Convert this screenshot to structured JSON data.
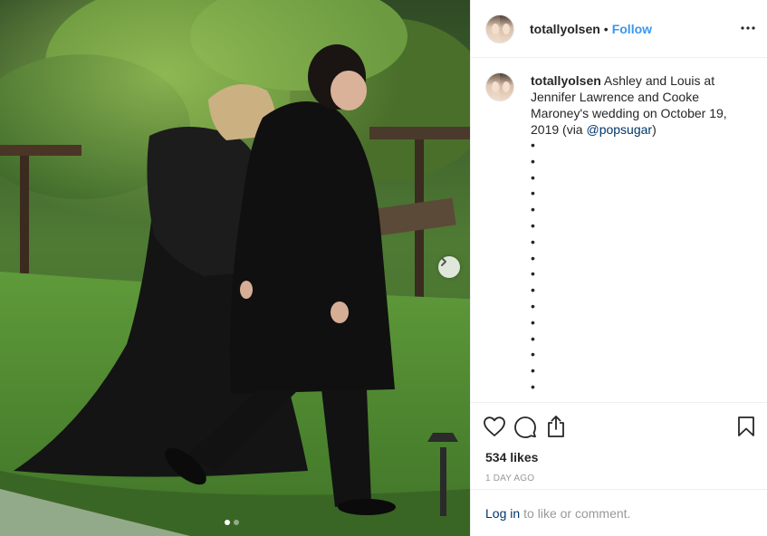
{
  "post": {
    "username": "totallyolsen",
    "separator": "•",
    "follow_label": "Follow",
    "more_icon": "more-options-icon",
    "caption": {
      "username": "totallyolsen",
      "text_before_mention": " Ashley and Louis at Jennifer Lawrence and Cooke Maroney's wedding on October 19, 2019 (via ",
      "mention": "@popsugar",
      "text_after_mention": ")",
      "bullets": [
        "•",
        "•",
        "•",
        "•",
        "•",
        "•",
        "•",
        "•",
        "•",
        "•",
        "•",
        "•",
        "•",
        "•",
        "•",
        "•"
      ]
    },
    "likes": "534 likes",
    "timestamp": "1 DAY AGO",
    "carousel": {
      "current": 1,
      "total": 2
    },
    "login_prompt": {
      "link": "Log in",
      "rest": "to like or comment."
    }
  },
  "icons": [
    "heart-icon",
    "comment-icon",
    "share-icon",
    "bookmark-icon",
    "chevron-right-icon"
  ],
  "colors": {
    "link_blue": "#3897f0",
    "mention_blue": "#003569",
    "muted": "#999999",
    "text": "#262626"
  }
}
